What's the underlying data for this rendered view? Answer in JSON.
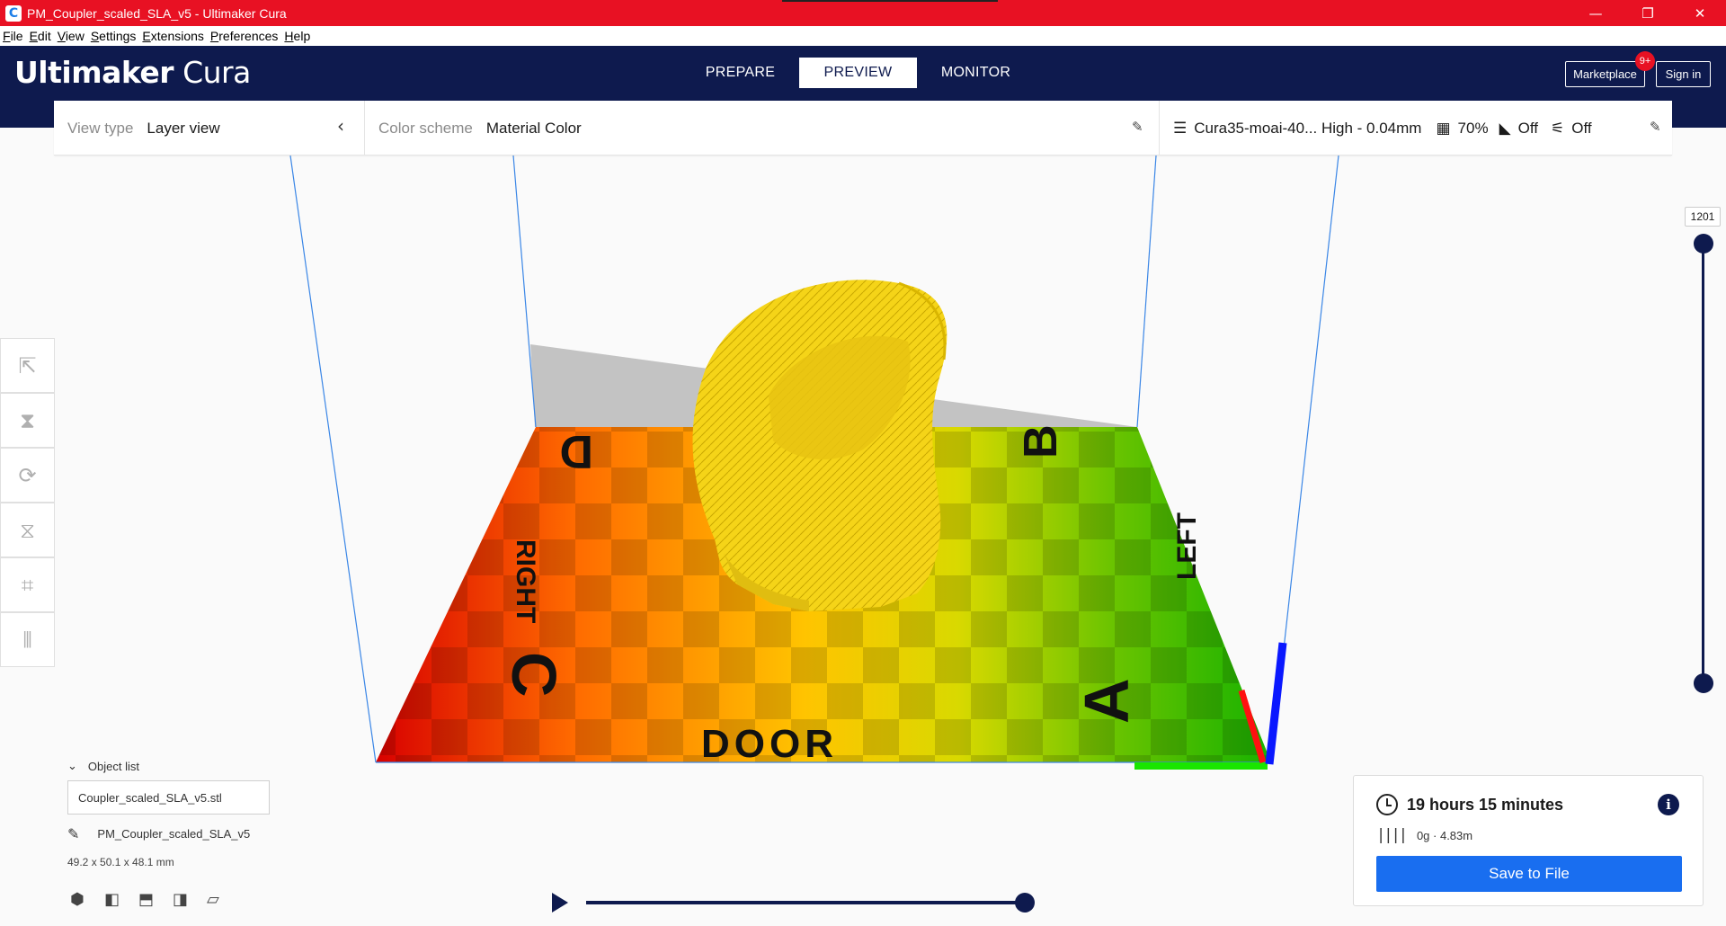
{
  "window": {
    "title": "PM_Coupler_scaled_SLA_v5 - Ultimaker Cura",
    "minimize": "—",
    "restore": "❐",
    "close": "✕"
  },
  "menu": [
    "File",
    "Edit",
    "View",
    "Settings",
    "Extensions",
    "Preferences",
    "Help"
  ],
  "header": {
    "logo_bold": "Ultimaker",
    "logo_light": "Cura",
    "stages": [
      {
        "label": "PREPARE",
        "active": false
      },
      {
        "label": "PREVIEW",
        "active": true
      },
      {
        "label": "MONITOR",
        "active": false
      }
    ],
    "marketplace_label": "Marketplace",
    "marketplace_badge": "9+",
    "signin_label": "Sign in"
  },
  "viewbar": {
    "view_type_label": "View type",
    "view_type_value": "Layer view",
    "color_scheme_label": "Color scheme",
    "color_scheme_value": "Material Color",
    "profile": "Cura35-moai-40... High - 0.04mm",
    "infill": "70%",
    "support": "Off",
    "adhesion": "Off"
  },
  "buildplate": {
    "labels": [
      "D",
      "B",
      "RIGHT",
      "LEFT",
      "C",
      "A",
      "DOOR"
    ],
    "model_color": "#f5d418"
  },
  "layer_slider": {
    "current_layer": "1201"
  },
  "object_list": {
    "header": "Object list",
    "file": "Coupler_scaled_SLA_v5.stl",
    "job_name": "PM_Coupler_scaled_SLA_v5",
    "dimensions": "49.2 x 50.1 x 48.1 mm"
  },
  "print_info": {
    "time": "19 hours 15 minutes",
    "material": "0g · 4.83m",
    "save_label": "Save to File"
  },
  "colors": {
    "titlebar": "#e81123",
    "header": "#0e1a4e",
    "accent": "#196ef0"
  }
}
